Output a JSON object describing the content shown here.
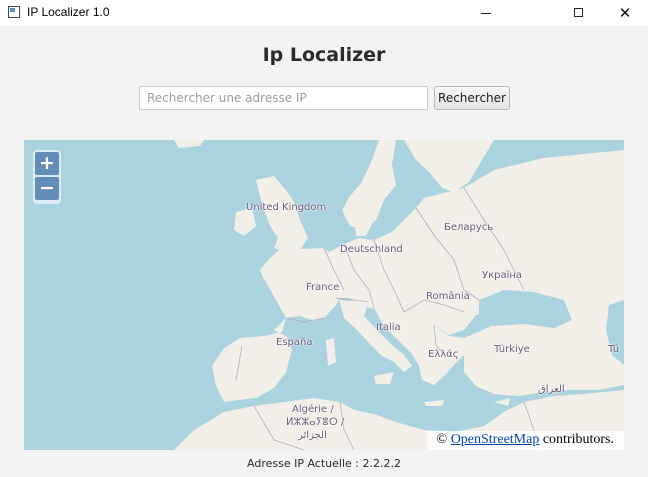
{
  "window": {
    "title": "IP Localizer 1.0",
    "icon": "app-window-icon",
    "minimize_icon": "minimize-icon",
    "maximize_icon": "maximize-icon",
    "close_icon": "close-icon",
    "close_glyph": "✕"
  },
  "header": {
    "title": "Ip Localizer"
  },
  "search": {
    "placeholder": "Rechercher une adresse IP",
    "value": "",
    "button_label": "Rechercher"
  },
  "map": {
    "zoom_in_label": "+",
    "zoom_out_label": "−",
    "attribution_prefix": "©",
    "attribution_link": "OpenStreetMap",
    "attribution_suffix": " contributors.",
    "labels": {
      "united_kingdom": "United Kingdom",
      "deutschland": "Deutschland",
      "belarus": "Беларусь",
      "france": "France",
      "ukraine": "Україна",
      "romania": "România",
      "italia": "Italia",
      "espana": "España",
      "ellas": "Ελλάς",
      "turkiye": "Türkiye",
      "tu": "Tü",
      "algerie_1": "Algérie /",
      "algerie_2": "ⵍⵣⵣⴰⵢⴻⵔ /",
      "algerie_3": "الجزائر",
      "iraq": "العراق"
    },
    "colors": {
      "sea": "#aad3df",
      "land": "#f2efe9",
      "border": "#b7a8c4"
    }
  },
  "status": {
    "text": "Adresse IP Actuelle : 2.2.2.2"
  }
}
